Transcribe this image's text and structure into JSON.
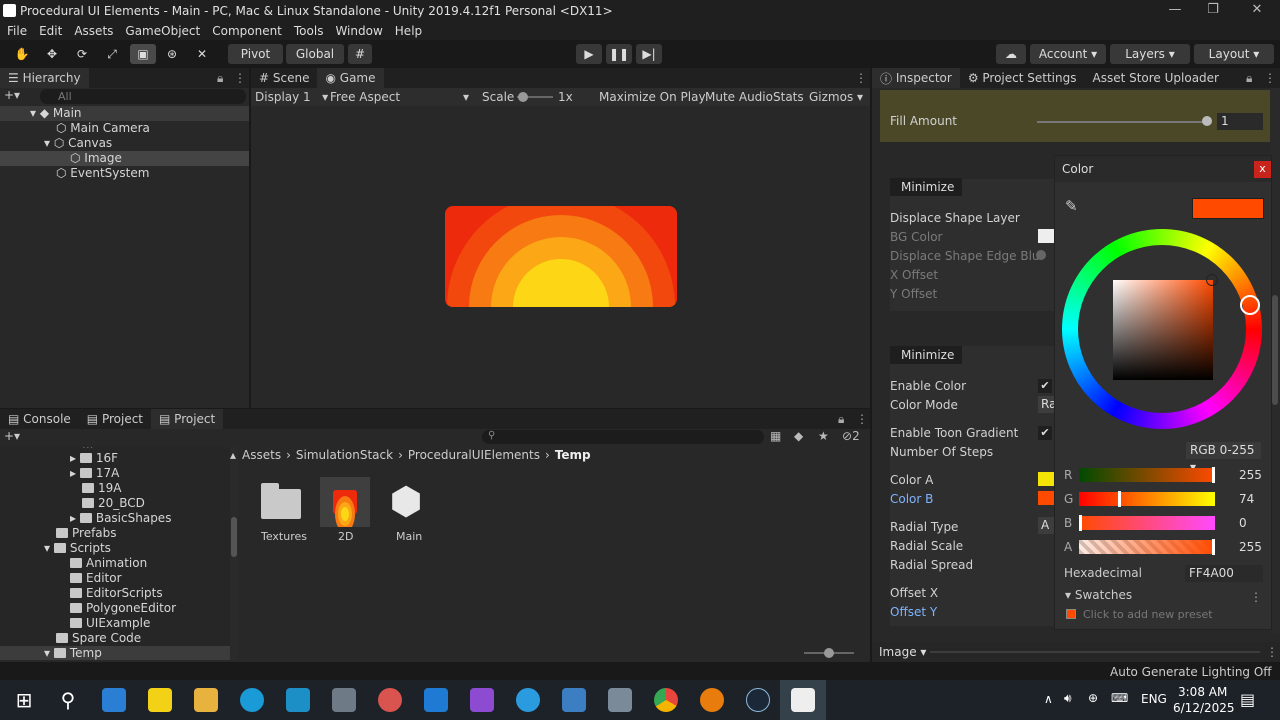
{
  "window": {
    "title": "Procedural UI Elements - Main - PC, Mac & Linux Standalone - Unity 2019.4.12f1 Personal <DX11>"
  },
  "menu": [
    "File",
    "Edit",
    "Assets",
    "GameObject",
    "Component",
    "Tools",
    "Window",
    "Help"
  ],
  "toolbar": {
    "pivot": "Pivot",
    "global": "Global",
    "account": "Account",
    "layers": "Layers",
    "layout": "Layout"
  },
  "hierarchy": {
    "tab": "Hierarchy",
    "search_placeholder": "All",
    "scene": "Main",
    "items": [
      "Main Camera",
      "Canvas",
      "Image",
      "EventSystem"
    ]
  },
  "game": {
    "tabs": [
      "Scene",
      "Game"
    ],
    "display": "Display 1",
    "aspect": "Free Aspect",
    "scale_label": "Scale",
    "scale_value": "1x",
    "maximize": "Maximize On Play",
    "mute": "Mute Audio",
    "stats": "Stats",
    "gizmos": "Gizmos"
  },
  "project": {
    "tabs": [
      "Console",
      "Project",
      "Project"
    ],
    "search_count": "2",
    "breadcrumb": [
      "Assets",
      "SimulationStack",
      "ProceduralUIElements",
      "Temp"
    ],
    "tree": [
      {
        "label": "16F",
        "indent": 3
      },
      {
        "label": "17A",
        "indent": 3
      },
      {
        "label": "19A",
        "indent": 3
      },
      {
        "label": "20_BCD",
        "indent": 3
      },
      {
        "label": "BasicShapes",
        "indent": 3
      },
      {
        "label": "Prefabs",
        "indent": 2
      },
      {
        "label": "Scripts",
        "indent": 2
      },
      {
        "label": "Animation",
        "indent": 3
      },
      {
        "label": "Editor",
        "indent": 3
      },
      {
        "label": "EditorScripts",
        "indent": 3
      },
      {
        "label": "PolygoneEditor",
        "indent": 3
      },
      {
        "label": "UIExample",
        "indent": 3
      },
      {
        "label": "Spare Code",
        "indent": 2
      },
      {
        "label": "Temp",
        "indent": 2
      }
    ],
    "assets": [
      "Textures",
      "2D",
      "Main"
    ]
  },
  "inspector": {
    "tabs": [
      "Inspector",
      "Project Settings",
      "Asset Store Uploader"
    ],
    "fill_amount_label": "Fill Amount",
    "fill_amount_value": "1",
    "minimize1": "Minimize",
    "displace_shape_layer": "Displace Shape Layer",
    "bg_color": "BG Color",
    "edge_blur": "Displace Shape Edge Blur",
    "x_offset": "X Offset",
    "y_offset": "Y Offset",
    "minimize2": "Minimize",
    "enable_color": "Enable Color",
    "color_mode": "Color Mode",
    "color_mode_value": "Ra",
    "enable_toon": "Enable Toon Gradient",
    "num_steps": "Number Of Steps",
    "color_a": "Color A",
    "color_b": "Color B",
    "radial_type": "Radial Type",
    "radial_type_value": "A",
    "radial_scale": "Radial Scale",
    "radial_spread": "Radial Spread",
    "offset_x": "Offset X",
    "offset_y": "Offset Y",
    "footer": "Image"
  },
  "color_picker": {
    "title": "Color",
    "close": "x",
    "mode": "RGB 0-255",
    "r_label": "R",
    "r_value": "255",
    "g_label": "G",
    "g_value": "74",
    "b_label": "B",
    "b_value": "0",
    "a_label": "A",
    "a_value": "255",
    "hex_label": "Hexadecimal",
    "hex_value": "FF4A00",
    "swatches": "Swatches",
    "swatch_hint": "Click to add new preset",
    "current_color": "#ff4a00"
  },
  "status": {
    "lighting": "Auto Generate Lighting Off"
  },
  "taskbar": {
    "lang": "ENG",
    "time": "3:08 AM",
    "date": "6/12/2025"
  }
}
